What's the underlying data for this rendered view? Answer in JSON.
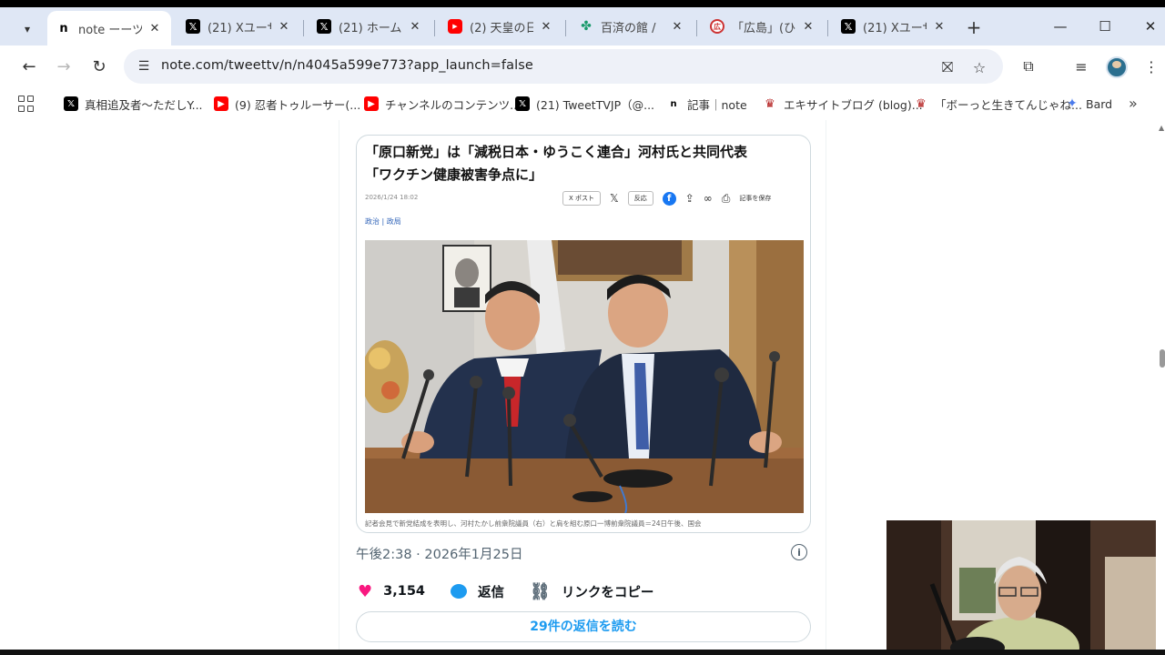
{
  "tabs": [
    {
      "title": "note ーーツ",
      "favicon": "note",
      "active": true
    },
    {
      "title": "(21) Xユーザー",
      "favicon": "x",
      "active": false
    },
    {
      "title": "(21) ホーム /",
      "favicon": "x",
      "active": false
    },
    {
      "title": "(2) 天皇の日",
      "favicon": "youtube",
      "active": false
    },
    {
      "title": "百済の館 / ",
      "favicon": "hyakusai",
      "active": false
    },
    {
      "title": "「広島」(ひろ",
      "favicon": "hiro",
      "active": false
    },
    {
      "title": "(21) Xユーザー",
      "favicon": "x",
      "active": false
    }
  ],
  "toolbar": {
    "url": "note.com/tweettv/n/n4045a599e773?app_launch=false"
  },
  "bookmarks": [
    {
      "label": "真相追及者〜ただしY...",
      "favicon": "x"
    },
    {
      "label": "(9) 忍者トゥルーサー(...",
      "favicon": "youtube"
    },
    {
      "label": "チャンネルのコンテンツ...",
      "favicon": "youtube"
    },
    {
      "label": "(21) TweetTVJP（@...",
      "favicon": "x"
    },
    {
      "label": "記事｜note",
      "favicon": "note"
    },
    {
      "label": "エキサイトブログ (blog)...",
      "favicon": "excite"
    },
    {
      "label": "「ボーっと生きてんじゃね...",
      "favicon": "excite"
    },
    {
      "label": "Bard",
      "favicon": "bard"
    }
  ],
  "article": {
    "title_line1": "「原口新党」は「減税日本・ゆうこく連合」河村氏と共同代表",
    "title_line2": "「ワクチン健康被害争点に」",
    "date": "2026/1/24 18:02",
    "post_label": "X ポスト",
    "repost_label": "反応",
    "save_label": "記事を保存",
    "category": "政治 | 政局",
    "caption": "記者会見で新党結成を表明し、河村たかし前衆院議員（右）と肩を組む原口一博前衆院議員＝24日午後、国会"
  },
  "tweet": {
    "time": "午後2:38 · 2026年1月25日",
    "likes": "3,154",
    "reply_label": "返信",
    "copy_link_label": "リンクをコピー",
    "read_replies_label": "29件の返信を読む"
  }
}
